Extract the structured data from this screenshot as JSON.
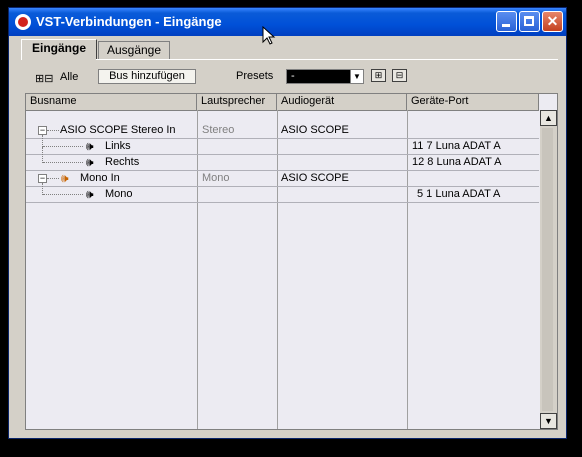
{
  "window": {
    "title": "VST-Verbindungen - Eingänge"
  },
  "tabs": [
    {
      "label": "Eingänge"
    },
    {
      "label": "Ausgänge"
    }
  ],
  "toolbar": {
    "alle_label": "Alle",
    "expand_icons": "⊞⊟",
    "bus_button_label": "Bus hinzufügen",
    "presets_label": "Presets",
    "presets_value": "-"
  },
  "table": {
    "headers": [
      "Busname",
      "Lautsprecher",
      "Audiogerät",
      "Geräte-Port"
    ],
    "rows": [
      {
        "busname": "ASIO SCOPE Stereo In",
        "lautsprecher": "Stereo",
        "audiogeraet": "ASIO SCOPE",
        "port": ""
      },
      {
        "busname": "Links",
        "lautsprecher": "",
        "audiogeraet": "",
        "port": "11 7 Luna ADAT A"
      },
      {
        "busname": "Rechts",
        "lautsprecher": "",
        "audiogeraet": "",
        "port": "12 8 Luna ADAT A"
      },
      {
        "busname": "Mono In",
        "lautsprecher": "Mono",
        "audiogeraet": "ASIO SCOPE",
        "port": ""
      },
      {
        "busname": "Mono",
        "lautsprecher": "",
        "audiogeraet": "",
        "port": "5 1 Luna ADAT A"
      }
    ]
  },
  "icons": {
    "speaker": "speaker-icon",
    "tree_collapse": "tree-collapse-icon"
  },
  "colors": {
    "titlebar": "#0050d8",
    "close_button": "#c4411f",
    "table_bg": "#ecebf2"
  }
}
